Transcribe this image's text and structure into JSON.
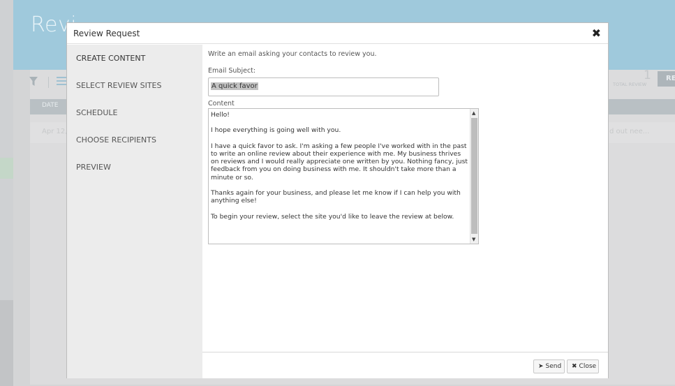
{
  "background": {
    "page_title": "Revi",
    "date_header": "DATE",
    "row_date": "Apr 12,",
    "row_snippet": "d out nee...",
    "total_count": "1",
    "total_label": "TOTAL REVIEW",
    "re_button": "RE"
  },
  "modal": {
    "title": "Review Request",
    "close_icon": "✖",
    "nav": [
      {
        "label": "CREATE CONTENT"
      },
      {
        "label": "SELECT REVIEW SITES"
      },
      {
        "label": "SCHEDULE"
      },
      {
        "label": "CHOOSE RECIPIENTS"
      },
      {
        "label": "PREVIEW"
      }
    ],
    "intro": "Write an email asking your contacts to review you.",
    "subject_label": "Email Subject:",
    "subject_value": "A quick favor",
    "content_label": "Content",
    "content_paragraphs": [
      "Hello!",
      "I hope everything is going well with you.",
      "I have a quick favor to ask. I'm asking a few people I've worked with in the past to write an online review about their experience with me. My business thrives on reviews and I would really appreciate one written by you. Nothing fancy, just feedback from you on doing business with me. It shouldn't take more than a minute or so.",
      "Thanks again for your business, and please let me know if I can help you with anything else!",
      "To begin your review, select the site you'd like to leave the review at below."
    ],
    "footer": {
      "send_label": "Send",
      "close_label": "Close"
    }
  },
  "icons": {
    "filter": "filter-icon",
    "list": "list-icon",
    "send": "send-icon",
    "close": "close-icon"
  }
}
